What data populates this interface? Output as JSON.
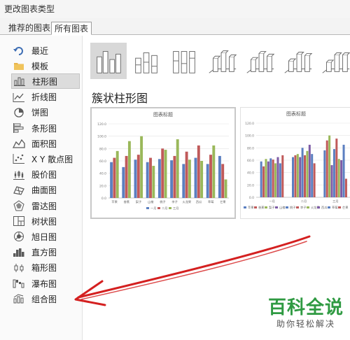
{
  "window": {
    "title": "更改图表类型"
  },
  "tabs": [
    {
      "label": "推荐的图表",
      "active": false
    },
    {
      "label": "所有图表",
      "active": true
    }
  ],
  "sidebar": {
    "selected_index": 2,
    "items": [
      {
        "label": "最近",
        "icon": "recent-icon"
      },
      {
        "label": "模板",
        "icon": "template-folder-icon"
      },
      {
        "label": "柱形图",
        "icon": "column-chart-icon"
      },
      {
        "label": "折线图",
        "icon": "line-chart-icon"
      },
      {
        "label": "饼图",
        "icon": "pie-chart-icon"
      },
      {
        "label": "条形图",
        "icon": "bar-chart-icon"
      },
      {
        "label": "面积图",
        "icon": "area-chart-icon"
      },
      {
        "label": "X Y 散点图",
        "icon": "scatter-chart-icon"
      },
      {
        "label": "股价图",
        "icon": "stock-chart-icon"
      },
      {
        "label": "曲面图",
        "icon": "surface-chart-icon"
      },
      {
        "label": "雷达图",
        "icon": "radar-chart-icon"
      },
      {
        "label": "树状图",
        "icon": "treemap-chart-icon"
      },
      {
        "label": "旭日图",
        "icon": "sunburst-chart-icon"
      },
      {
        "label": "直方图",
        "icon": "histogram-chart-icon"
      },
      {
        "label": "箱形图",
        "icon": "box-whisker-chart-icon"
      },
      {
        "label": "瀑布图",
        "icon": "waterfall-chart-icon"
      },
      {
        "label": "组合图",
        "icon": "combo-chart-icon"
      }
    ]
  },
  "main": {
    "section_title": "簇状柱形图",
    "subtypes_count": 7,
    "selected_subtype": 0
  },
  "watermark": {
    "main": "百科全说",
    "sub": "助你轻松解决"
  },
  "colors": {
    "series": [
      "#5b7fc0",
      "#c05a5a",
      "#9ab85a",
      "#7d5ba6"
    ],
    "arrow": "#d42020",
    "watermark": "#2f9a42"
  },
  "chart_data": [
    {
      "type": "bar",
      "title": "图表标题",
      "categories": [
        "苹果",
        "香蕉",
        "梨子",
        "山楂",
        "桃子",
        "李子",
        "火龙果",
        "西瓜",
        "草莓",
        "芒果"
      ],
      "series": [
        {
          "name": "一月",
          "values": [
            58,
            50,
            62,
            58,
            63,
            61,
            55,
            65,
            55,
            68
          ]
        },
        {
          "name": "二月",
          "values": [
            65,
            68,
            70,
            65,
            80,
            68,
            75,
            85,
            70,
            55
          ]
        },
        {
          "name": "三月",
          "values": [
            76,
            92,
            100,
            52,
            78,
            95,
            62,
            60,
            85,
            30
          ]
        }
      ],
      "yticks": [
        "0.0",
        "20.0",
        "40.0",
        "60.0",
        "80.0",
        "100.0",
        "120.0"
      ],
      "ylim": [
        0,
        120
      ],
      "legend": "bottom",
      "grid": true
    },
    {
      "type": "bar",
      "title": "图表标题",
      "categories": [
        "一月",
        "二月",
        "三月"
      ],
      "series": [
        {
          "name": "苹果",
          "values": [
            58,
            65,
            76
          ]
        },
        {
          "name": "香蕉",
          "values": [
            50,
            68,
            92
          ]
        },
        {
          "name": "梨子",
          "values": [
            62,
            70,
            100
          ]
        },
        {
          "name": "山楂",
          "values": [
            58,
            65,
            52
          ]
        },
        {
          "name": "桃子",
          "values": [
            63,
            80,
            78
          ]
        },
        {
          "name": "李子",
          "values": [
            61,
            68,
            95
          ]
        },
        {
          "name": "火龙果",
          "values": [
            55,
            75,
            62
          ]
        },
        {
          "name": "西瓜",
          "values": [
            65,
            85,
            60
          ]
        },
        {
          "name": "草莓",
          "values": [
            55,
            70,
            85
          ]
        },
        {
          "name": "芒果",
          "values": [
            68,
            55,
            30
          ]
        }
      ],
      "yticks": [
        "0.0",
        "20.0",
        "40.0",
        "60.0",
        "80.0",
        "100.0",
        "120.0"
      ],
      "ylim": [
        0,
        120
      ],
      "legend": "bottom",
      "grid": true
    }
  ]
}
